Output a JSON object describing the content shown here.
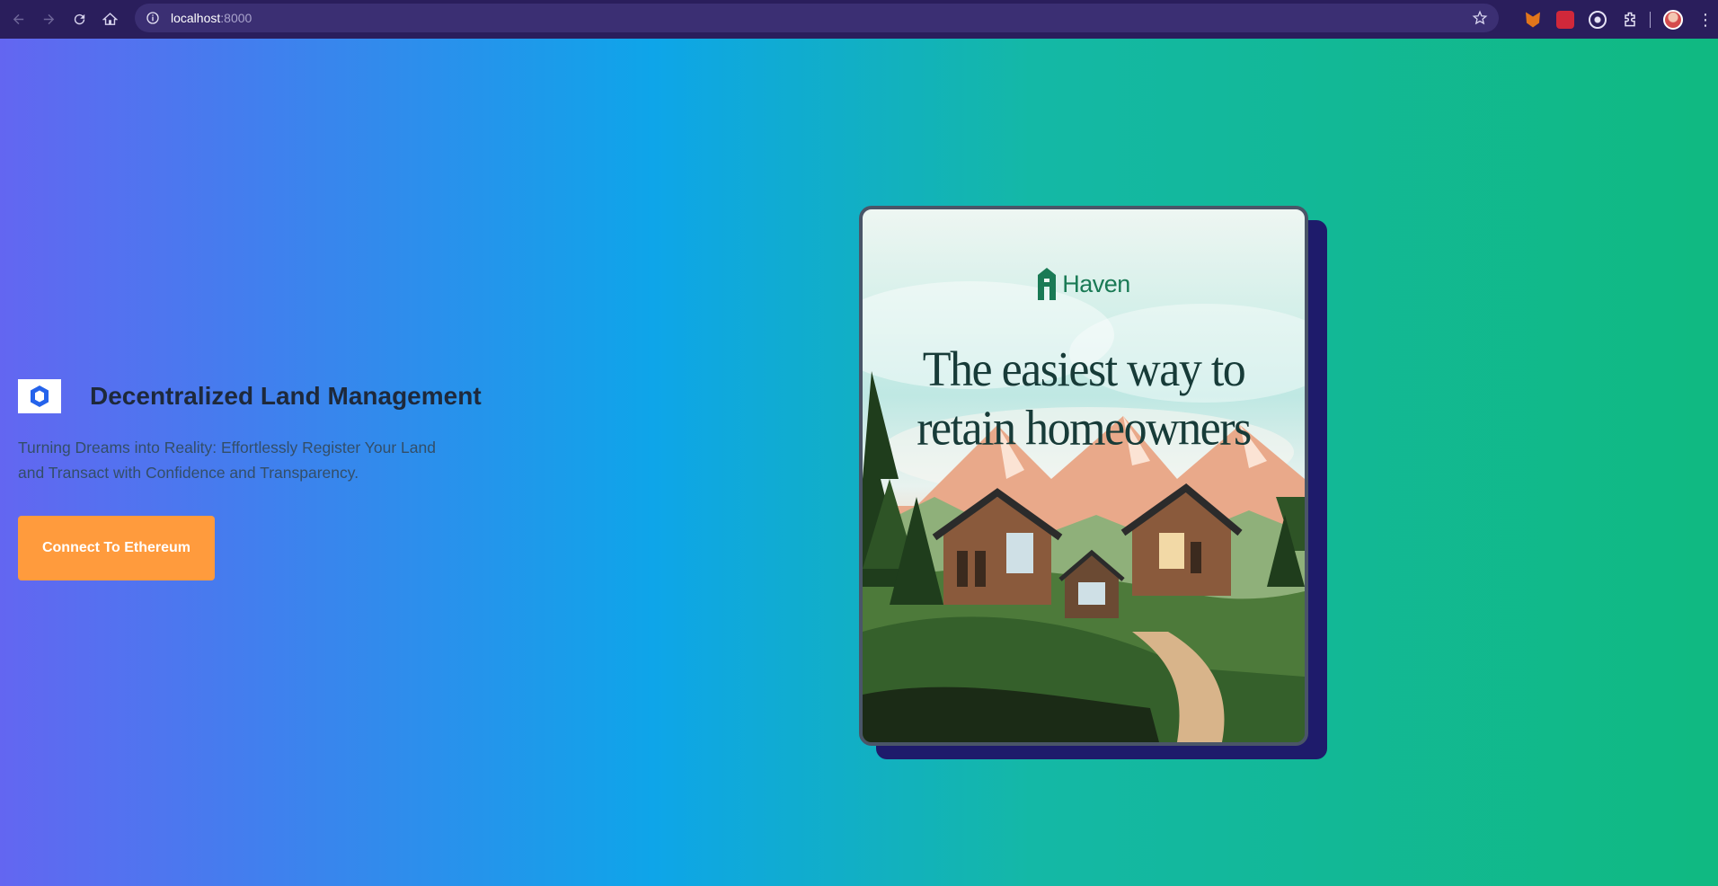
{
  "browser": {
    "url_host": "localhost",
    "url_port": ":8000"
  },
  "hero": {
    "title": "Decentralized Land Management",
    "subtitle": "Turning Dreams into Reality: Effortlessly Register Your Land and Transact with Confidence and Transparency.",
    "cta_label": "Connect To Ethereum"
  },
  "card": {
    "brand": "Haven",
    "headline_line1": "The easiest way to",
    "headline_line2": "retain homeowners"
  },
  "colors": {
    "gradient_start": "#6366f1",
    "gradient_mid": "#0ea5e9",
    "gradient_end": "#10b981",
    "cta": "#ff9b3d",
    "card_shadow": "#1e1b6b",
    "brand_green": "#1a7a55"
  }
}
